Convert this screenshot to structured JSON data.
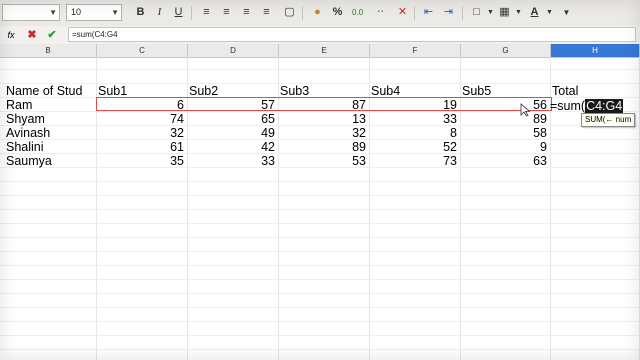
{
  "toolbar": {
    "font_name_value": "",
    "font_size_value": "10",
    "bold_label": "B",
    "italic_label": "I",
    "underline_label": "U",
    "percent_label": "%"
  },
  "formula_bar": {
    "function_wizard_label": "fx",
    "input_value": "=sum(C4:G4"
  },
  "columns": [
    "B",
    "C",
    "D",
    "E",
    "F",
    "G",
    "H"
  ],
  "selected_column": "H",
  "sheet": {
    "headers": [
      "Name of Stud",
      "Sub1",
      "Sub2",
      "Sub3",
      "Sub4",
      "Sub5",
      "Total"
    ],
    "rows": [
      {
        "name": "Ram",
        "values": [
          "6",
          "57",
          "87",
          "19",
          "56"
        ]
      },
      {
        "name": "Shyam",
        "values": [
          "74",
          "65",
          "13",
          "33",
          "89"
        ]
      },
      {
        "name": "Avinash",
        "values": [
          "32",
          "49",
          "32",
          "8",
          "58"
        ]
      },
      {
        "name": "Shalini",
        "values": [
          "61",
          "42",
          "89",
          "52",
          "9"
        ]
      },
      {
        "name": "Saumya",
        "values": [
          "35",
          "33",
          "53",
          "73",
          "63"
        ]
      }
    ]
  },
  "editing_cell": {
    "prefix": "=sum(",
    "reference": "C4:G4"
  },
  "tooltip": "SUM(← num",
  "colors": {
    "reference_border": "#e04a4a",
    "selected_column_header": "#3778d7"
  }
}
